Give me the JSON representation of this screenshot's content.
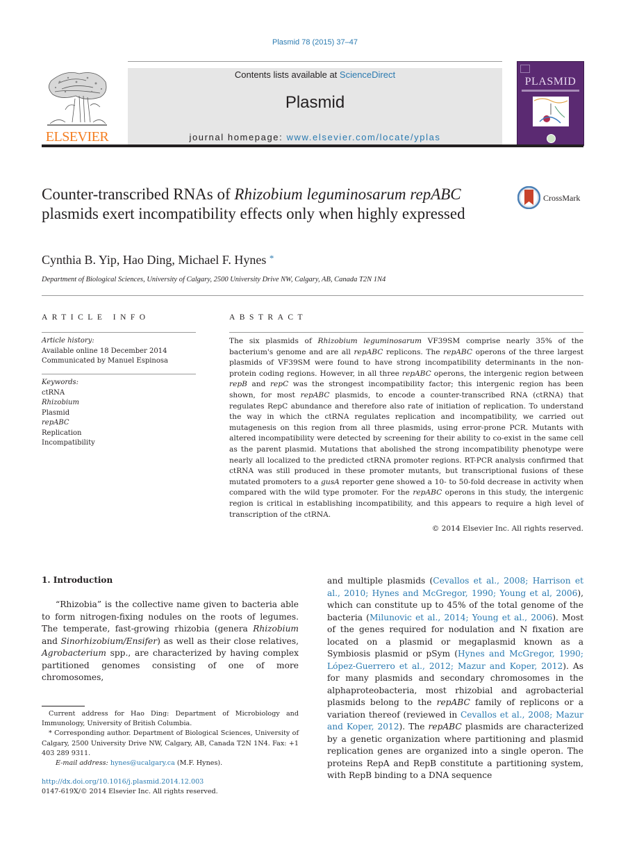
{
  "header": {
    "journal_ref": "Plasmid 78 (2015) 37–47",
    "contents_prefix": "Contents lists available at ",
    "contents_link": "ScienceDirect",
    "journal_title": "Plasmid",
    "homepage_prefix": "journal homepage: ",
    "homepage_link": "www.elsevier.com/locate/yplas",
    "publisher_wordmark": "ELSEVIER",
    "cover_title": "PLASMID",
    "crossmark_label": "CrossMark",
    "colors": {
      "link": "#2a7ab0",
      "elsevier_orange": "#f47d20",
      "cover_purple": "#5b2a72",
      "masthead_gray": "#e6e6e6"
    }
  },
  "article": {
    "title_part1": "Counter-transcribed RNAs of ",
    "title_italic": "Rhizobium leguminosarum repABC",
    "title_part2": " plasmids exert incompatibility effects only when highly expressed",
    "authors": "Cynthia B. Yip, Hao Ding, Michael F. Hynes",
    "author_mark": "*",
    "affiliation": "Department of Biological Sciences, University of Calgary, 2500 University Drive NW, Calgary, AB, Canada T2N 1N4"
  },
  "article_info": {
    "heading": "ARTICLE INFO",
    "history_label": "Article history:",
    "history": [
      "Available online 18 December 2014",
      "Communicated by Manuel Espinosa"
    ],
    "keywords_label": "Keywords:",
    "keywords": [
      "ctRNA",
      "Rhizobium",
      "Plasmid",
      "repABC",
      "Replication",
      "Incompatibility"
    ]
  },
  "abstract": {
    "heading": "ABSTRACT",
    "s1": "The six plasmids of ",
    "s1_i": "Rhizobium leguminosarum",
    "s2": " VF39SM comprise nearly 35% of the bacterium's genome and are all ",
    "s2_i": "repABC",
    "s3": " replicons. The ",
    "s3_i": "repABC",
    "s4": " operons of the three largest plasmids of VF39SM were found to have strong incompatibility determinants in the non-protein coding regions. However, in all three ",
    "s4_i": "repABC",
    "s5": " operons, the intergenic region between ",
    "s5_i": "repB",
    "s6": " and ",
    "s6_i": "repC",
    "s7": " was the strongest incompatibility factor; this intergenic region has been shown, for most ",
    "s7_i": "repABC",
    "s8": " plasmids, to encode a counter-transcribed RNA (ctRNA) that regulates RepC abundance and therefore also rate of initiation of replication. To understand the way in which the ctRNA regulates replication and incompatibility, we carried out mutagenesis on this region from all three plasmids, using error-prone PCR. Mutants with altered incompatibility were detected by screening for their ability to co-exist in the same cell as the parent plasmid. Mutations that abolished the strong incompatibility phenotype were nearly all localized to the predicted ctRNA promoter regions. RT-PCR analysis confirmed that ctRNA was still produced in these promoter mutants, but transcriptional fusions of these mutated promoters to a ",
    "s8_i": "gusA",
    "s9": " reporter gene showed a 10- to 50-fold decrease in activity when compared with the wild type promoter. For the ",
    "s9_i": "repABC",
    "s10": " operons in this study, the intergenic region is critical in establishing incompatibility, and this appears to require a high level of transcription of the ctRNA.",
    "copyright": "© 2014 Elsevier Inc. All rights reserved."
  },
  "introduction": {
    "heading": "1.  Introduction",
    "left": {
      "p1": "“Rhizobia” is the collective name given to bacteria able to form nitrogen-fixing nodules on the roots of legumes. The temperate, fast-growing rhizobia (genera ",
      "p1_i": "Rhizobium",
      "p2": " and ",
      "p2_i": "Sinorhizobium/Ensifer",
      "p3": ") as well as their close relatives, ",
      "p3_i": "Agrobacterium",
      "p4": " spp., are characterized by having complex partitioned genomes consisting of one of more chromosomes,"
    },
    "right": {
      "r1": "and multiple plasmids (",
      "r1_link": "Cevallos et al., 2008; Harrison et al., 2010; Hynes and McGregor, 1990; Young et al, 2006",
      "r2": "), which can constitute up to 45% of the total genome of the bacteria (",
      "r2_link": "Milunovic et al., 2014; Young et al., 2006",
      "r3": "). Most of the genes required for nodulation and N fixation are located on a plasmid or megaplasmid known as a Symbiosis plasmid or pSym (",
      "r3_link": "Hynes and McGregor, 1990; López-Guerrero et al., 2012; Mazur and Koper, 2012",
      "r4": "). As for many plasmids and secondary chromosomes in the alphaproteobacteria, most rhizobial and agrobacterial plasmids belong to the ",
      "r4_i": "repABC",
      "r5": " family of replicons or a variation thereof (reviewed in ",
      "r5_link": "Cevallos et al., 2008; Mazur and Koper, 2012",
      "r6": "). The ",
      "r6_i": "repABC",
      "r7": " plasmids are characterized by a genetic organization where partitioning and plasmid replication genes are organized into a single operon. The proteins RepA and RepB constitute a partitioning system, with RepB binding to a DNA sequence"
    }
  },
  "footnotes": {
    "current_address": "Current address for Hao Ding: Department of Microbiology and Immunology, University of British Columbia.",
    "corresponding_mark": "*",
    "corresponding": " Corresponding author. Department of Biological Sciences, University of Calgary, 2500 University Drive NW, Calgary, AB, Canada T2N 1N4. Fax: +1 403 289 9311.",
    "email_label": "E-mail address: ",
    "email": "hynes@ucalgary.ca",
    "email_suffix": " (M.F. Hynes).",
    "doi": "http://dx.doi.org/10.1016/j.plasmid.2014.12.003",
    "issn": "0147-619X/© 2014 Elsevier Inc. All rights reserved."
  }
}
